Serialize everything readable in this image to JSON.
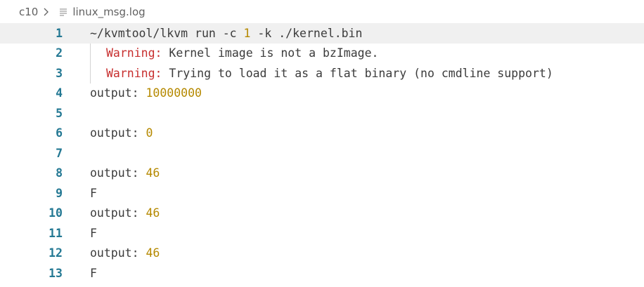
{
  "breadcrumb": {
    "folder": "c10",
    "separator_icon": "chevron-right-icon",
    "file_icon": "text-file-icon",
    "file": "linux_msg.log"
  },
  "colors": {
    "line_number": "#237893",
    "text": "#3b3b3b",
    "number": "#b58900",
    "warning": "#c72e2e",
    "current_line_bg": "#f0f0f0"
  },
  "lines": [
    {
      "num": "1",
      "a": "~/kvmtool/lkvm run -c ",
      "b": "1",
      "c": " -k ./kernel.bin"
    },
    {
      "num": "2",
      "warn": "Warning:",
      "rest": " Kernel image is not a bzImage."
    },
    {
      "num": "3",
      "warn": "Warning:",
      "rest": " Trying to load it as a flat binary (no cmdline support)"
    },
    {
      "num": "4",
      "label": "output: ",
      "value": "10000000"
    },
    {
      "num": "5"
    },
    {
      "num": "6",
      "label": "output: ",
      "value": "0"
    },
    {
      "num": "7"
    },
    {
      "num": "8",
      "label": "output: ",
      "value": "46"
    },
    {
      "num": "9",
      "text": "F"
    },
    {
      "num": "10",
      "label": "output: ",
      "value": "46"
    },
    {
      "num": "11",
      "text": "F"
    },
    {
      "num": "12",
      "label": "output: ",
      "value": "46"
    },
    {
      "num": "13",
      "text": "F"
    }
  ]
}
